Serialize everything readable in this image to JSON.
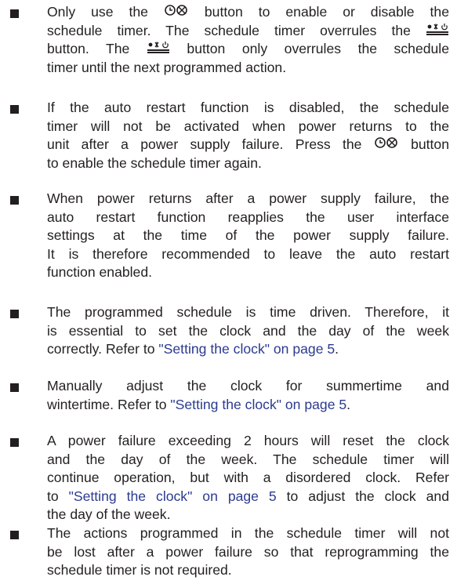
{
  "items": [
    {
      "lines": [
        [
          "Only use the ",
          {
            "icon": "timer-icon"
          },
          " button to enable or disable the"
        ],
        [
          "schedule timer. The schedule timer overrules the ",
          {
            "icon": "on-off-mode-icon"
          }
        ],
        [
          "button. The ",
          {
            "icon": "on-off-mode-icon"
          },
          " button only overrules the schedule"
        ],
        [
          "timer until the next programmed action."
        ]
      ]
    },
    {
      "lines": [
        [
          "If the auto restart function is disabled, the schedule"
        ],
        [
          "timer will not be activated when power returns to the"
        ],
        [
          "unit after a power supply failure. Press the ",
          {
            "icon": "timer-icon"
          },
          " button"
        ],
        [
          "to enable the schedule timer again."
        ]
      ]
    },
    {
      "lines": [
        [
          "When power returns after a power supply failure, the"
        ],
        [
          "auto restart function reapplies the user interface"
        ],
        [
          "settings at the time of the power supply failure."
        ],
        [
          "It is therefore recommended to leave the auto restart"
        ],
        [
          "function enabled."
        ]
      ]
    },
    {
      "lines": [
        [
          "The programmed schedule is time driven. Therefore, it"
        ],
        [
          "is essential to set the clock and the day of the week"
        ],
        [
          "correctly. Refer to ",
          {
            "link": "\"Setting the clock\" on page 5"
          },
          "."
        ]
      ]
    },
    {
      "lines": [
        [
          "Manually adjust the clock for summertime and"
        ],
        [
          "wintertime. Refer to ",
          {
            "link": "\"Setting the clock\" on page 5"
          },
          "."
        ]
      ]
    },
    {
      "lines": [
        [
          "A power failure exceeding 2 hours will reset the clock"
        ],
        [
          "and the day of the week. The schedule timer will"
        ],
        [
          "continue operation, but with a disordered clock. Refer"
        ],
        [
          "to ",
          {
            "link": "\"Setting the clock\" on page 5"
          },
          " to adjust the clock and"
        ],
        [
          "the day of the week."
        ]
      ]
    },
    {
      "lines": [
        [
          "The actions programmed in the schedule timer will not"
        ],
        [
          "be lost after a power failure so that reprogramming the"
        ],
        [
          "schedule timer is not required."
        ]
      ]
    }
  ],
  "colors": {
    "text": "#231f20",
    "link": "#2b3a8f"
  }
}
